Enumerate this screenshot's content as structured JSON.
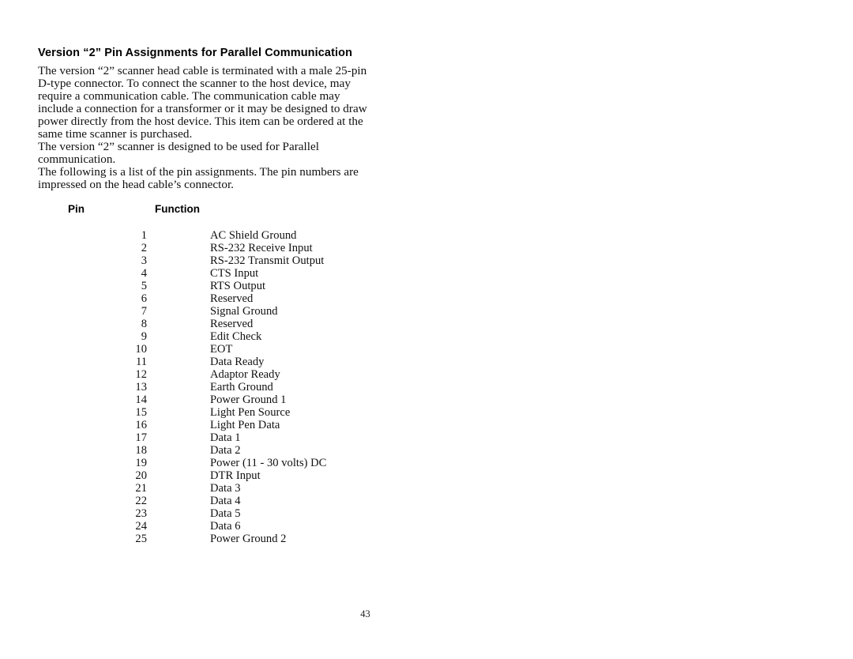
{
  "document": {
    "title": "Version “2” Pin Assignments for Parallel Communication",
    "paragraphs": {
      "p1": "The version “2” scanner head cable is terminated with a male 25-pin D-type connector. To connect the scanner to the host device, may require a communication cable. The communication cable may include a connection for a transformer or it may be designed to draw power directly from the host device. This item can be ordered at the same time scanner is purchased.",
      "p2": "The version “2” scanner is designed to be used for Parallel communication.",
      "p3": "The following is a list of the pin assignments. The pin numbers are impressed on the head cable’s connector."
    },
    "page_number": "43"
  },
  "pin_table": {
    "headers": {
      "pin": "Pin",
      "function": "Function"
    },
    "rows": [
      {
        "pin": "1",
        "function": "AC Shield Ground"
      },
      {
        "pin": "2",
        "function": "RS-232 Receive Input"
      },
      {
        "pin": "3",
        "function": "RS-232 Transmit Output"
      },
      {
        "pin": "4",
        "function": "CTS Input"
      },
      {
        "pin": "5",
        "function": "RTS Output"
      },
      {
        "pin": "6",
        "function": "Reserved"
      },
      {
        "pin": "7",
        "function": "Signal Ground"
      },
      {
        "pin": "8",
        "function": "Reserved"
      },
      {
        "pin": "9",
        "function": "Edit Check"
      },
      {
        "pin": "10",
        "function": "EOT"
      },
      {
        "pin": "11",
        "function": "Data Ready"
      },
      {
        "pin": "12",
        "function": "Adaptor Ready"
      },
      {
        "pin": "13",
        "function": "Earth Ground"
      },
      {
        "pin": "14",
        "function": "Power Ground 1"
      },
      {
        "pin": "15",
        "function": "Light Pen Source"
      },
      {
        "pin": "16",
        "function": "Light Pen Data"
      },
      {
        "pin": "17",
        "function": "Data 1"
      },
      {
        "pin": "18",
        "function": "Data 2"
      },
      {
        "pin": "19",
        "function": "Power (11 - 30 volts) DC"
      },
      {
        "pin": "20",
        "function": "DTR Input"
      },
      {
        "pin": "21",
        "function": "Data 3"
      },
      {
        "pin": "22",
        "function": "Data 4"
      },
      {
        "pin": "23",
        "function": "Data 5"
      },
      {
        "pin": "24",
        "function": "Data 6"
      },
      {
        "pin": "25",
        "function": "Power Ground 2"
      }
    ]
  }
}
